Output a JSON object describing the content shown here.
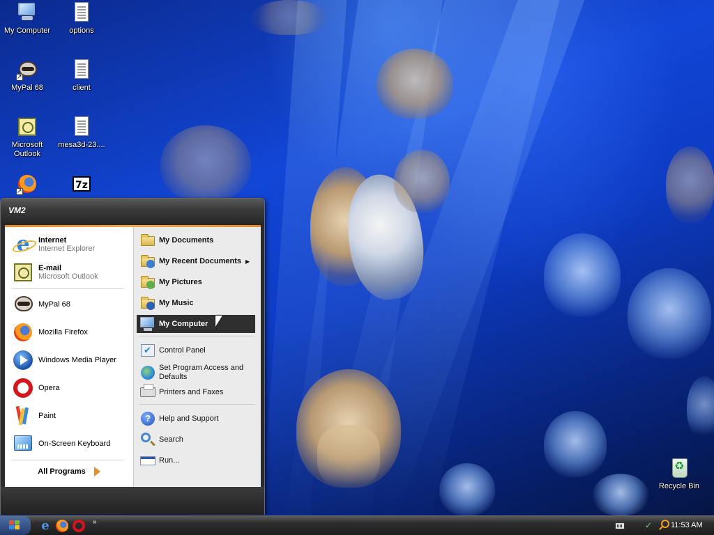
{
  "desktop": {
    "icons": [
      {
        "label": "My Computer",
        "icon": "my-computer-icon"
      },
      {
        "label": "options",
        "icon": "text-document-icon"
      },
      {
        "label": "MyPal 68",
        "icon": "mypal-icon"
      },
      {
        "label": "client",
        "icon": "text-document-icon"
      },
      {
        "label": "Microsoft Outlook",
        "icon": "outlook-icon"
      },
      {
        "label": "mesa3d-23....",
        "icon": "archive-file-icon"
      },
      {
        "label": "",
        "icon": "firefox-icon"
      },
      {
        "label": "",
        "icon": "7zip-icon"
      },
      {
        "label": "Recycle Bin",
        "icon": "recycle-bin-icon"
      }
    ]
  },
  "start_menu": {
    "user": "VM2",
    "pinned": [
      {
        "title": "Internet",
        "subtitle": "Internet Explorer",
        "icon": "internet-explorer-icon"
      },
      {
        "title": "E-mail",
        "subtitle": "Microsoft Outlook",
        "icon": "outlook-icon"
      }
    ],
    "recent": [
      {
        "label": "MyPal 68",
        "icon": "mypal-icon"
      },
      {
        "label": "Mozilla Firefox",
        "icon": "firefox-icon"
      },
      {
        "label": "Windows Media Player",
        "icon": "media-player-icon"
      },
      {
        "label": "Opera",
        "icon": "opera-icon"
      },
      {
        "label": "Paint",
        "icon": "paint-icon"
      },
      {
        "label": "On-Screen Keyboard",
        "icon": "keyboard-icon"
      }
    ],
    "all_programs": "All Programs",
    "places": [
      {
        "label": "My Documents",
        "icon": "folder-icon"
      },
      {
        "label": "My Recent Documents",
        "icon": "recent-documents-icon",
        "submenu": true
      },
      {
        "label": "My Pictures",
        "icon": "pictures-folder-icon"
      },
      {
        "label": "My Music",
        "icon": "music-folder-icon"
      },
      {
        "label": "My Computer",
        "icon": "my-computer-icon",
        "selected": true
      }
    ],
    "system": [
      {
        "label": "Control Panel",
        "icon": "control-panel-icon"
      },
      {
        "label": "Set Program Access and Defaults",
        "icon": "globe-icon"
      },
      {
        "label": "Printers and Faxes",
        "icon": "printer-icon"
      }
    ],
    "tools": [
      {
        "label": "Help and Support",
        "icon": "help-icon"
      },
      {
        "label": "Search",
        "icon": "search-icon"
      },
      {
        "label": "Run...",
        "icon": "run-icon"
      }
    ]
  },
  "taskbar": {
    "quick_launch": [
      "internet-explorer-icon",
      "firefox-icon",
      "opera-icon"
    ],
    "overflow": "»",
    "clock": "11:53 AM"
  },
  "colors": {
    "accent_orange": "#e58d2b",
    "menu_dark": "#2b2b2b",
    "selection": "#2f2f2f"
  }
}
